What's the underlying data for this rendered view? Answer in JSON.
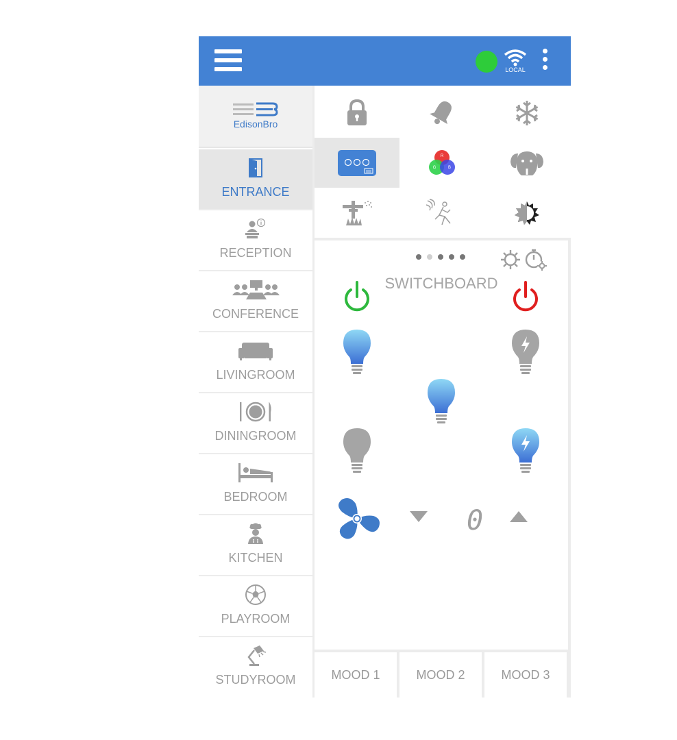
{
  "app": {
    "brand": "EdisonBro",
    "connection_label": "LOCAL",
    "status_color": "#2ecc3a",
    "accent": "#4382d4"
  },
  "sidebar": {
    "items": [
      {
        "label": "ENTRANCE",
        "icon": "door-icon",
        "active": true
      },
      {
        "label": "RECEPTION",
        "icon": "receptionist-icon",
        "active": false
      },
      {
        "label": "CONFERENCE",
        "icon": "conference-icon",
        "active": false
      },
      {
        "label": "LIVINGROOM",
        "icon": "sofa-icon",
        "active": false
      },
      {
        "label": "DININGROOM",
        "icon": "dining-icon",
        "active": false
      },
      {
        "label": "BEDROOM",
        "icon": "bed-icon",
        "active": false
      },
      {
        "label": "KITCHEN",
        "icon": "chef-icon",
        "active": false
      },
      {
        "label": "PLAYROOM",
        "icon": "soccer-ball-icon",
        "active": false
      },
      {
        "label": "STUDYROOM",
        "icon": "desk-lamp-icon",
        "active": false
      }
    ]
  },
  "devices": [
    "lock-icon",
    "bell-icon",
    "snowflake-icon",
    "switchboard-icon",
    "rgb-icon",
    "dog-icon",
    "sprinkler-icon",
    "motion-icon",
    "brightness-icon"
  ],
  "panel": {
    "title": "SWITCHBOARD",
    "page_count": 5,
    "current_page": 2,
    "fan_speed": "0"
  },
  "moods": [
    "MOOD 1",
    "MOOD 2",
    "MOOD 3"
  ]
}
